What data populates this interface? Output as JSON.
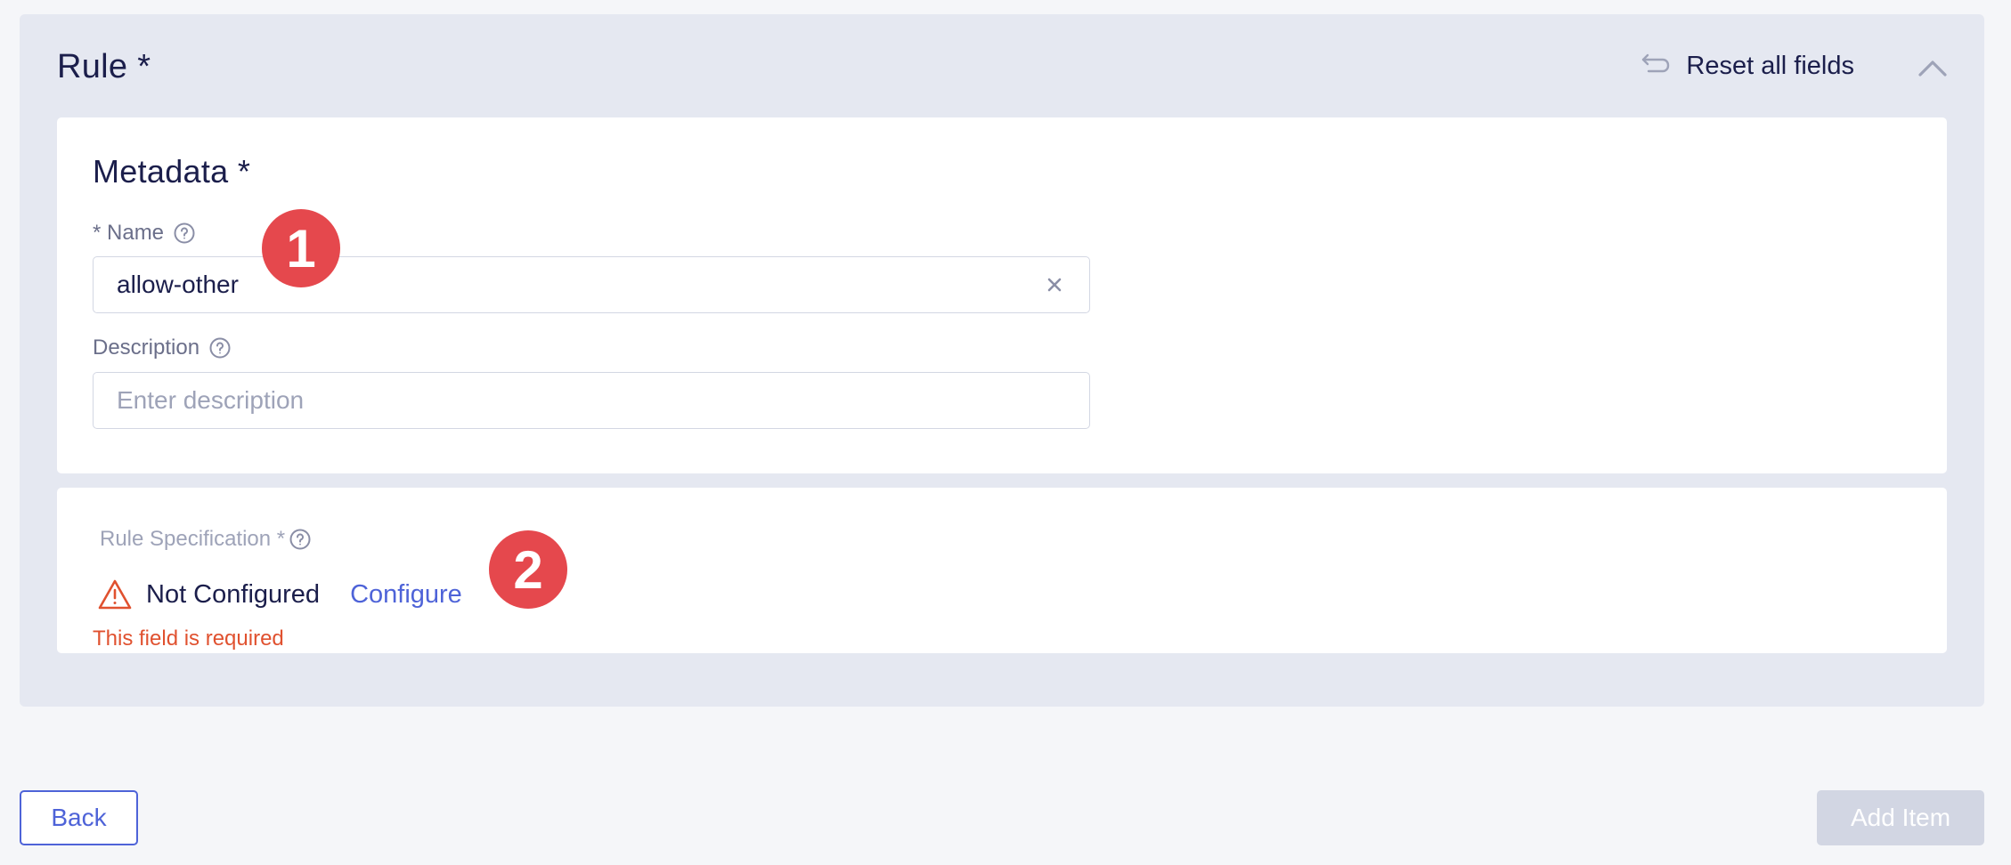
{
  "rule_section": {
    "title": "Rule",
    "required_marker": "*",
    "reset_label": "Reset all fields"
  },
  "metadata": {
    "title": "Metadata",
    "required_marker": "*",
    "name_label": "* Name",
    "name_value": "allow-other",
    "description_label": "Description",
    "description_placeholder": "Enter description"
  },
  "rule_spec": {
    "label": "Rule Specification *",
    "status": "Not Configured",
    "configure_label": "Configure",
    "error": "This field is required"
  },
  "annotations": [
    "1",
    "2"
  ],
  "footer": {
    "back_label": "Back",
    "add_label": "Add Item"
  },
  "colors": {
    "accent": "#4e63d8",
    "error": "#e0512f",
    "badge": "#e5484d",
    "panel_bg": "#e5e8f1"
  },
  "icons": [
    "reset-arrow-icon",
    "chevron-up-icon",
    "help-icon",
    "clear-icon",
    "warning-icon"
  ]
}
